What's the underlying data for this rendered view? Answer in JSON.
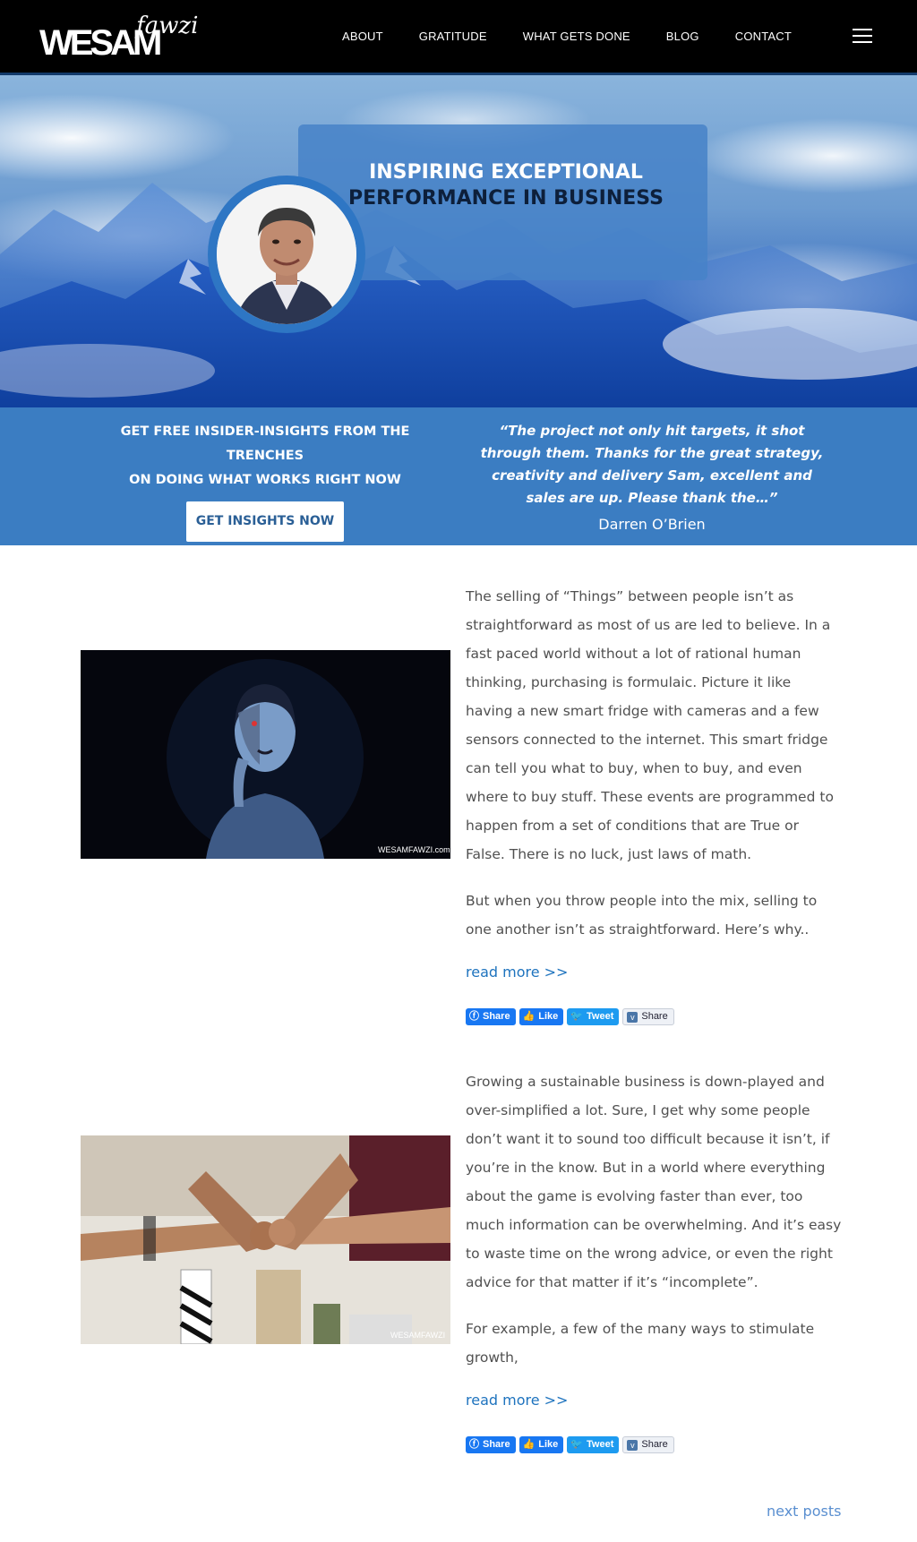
{
  "header": {
    "logo_main": "WESAM",
    "logo_script": "fawzi",
    "nav": [
      "ABOUT",
      "GRATITUDE",
      "WHAT GETS DONE",
      "BLOG",
      "CONTACT"
    ]
  },
  "hero": {
    "title_line1": "INSPIRING EXCEPTIONAL",
    "title_line2": "PERFORMANCE IN BUSINESS"
  },
  "band": {
    "insights_line1": "GET FREE INSIDER-INSIGHTS FROM THE TRENCHES",
    "insights_line2": "ON DOING WHAT WORKS RIGHT NOW",
    "cta_label": "GET INSIGHTS NOW",
    "quote": "“The project not only hit targets, it shot through them. Thanks for the great strategy, creativity and delivery Sam, excellent and sales are up. Please thank the…”",
    "quote_author": "Darren O’Brien"
  },
  "posts": [
    {
      "image_watermark": "WESAMFAWZI.com",
      "paragraphs": [
        "The selling of “Things” between people isn’t as straightforward as most of us are led to believe. In a fast paced world without a lot of rational human thinking, purchasing is formulaic.  Picture it like having a new smart fridge with cameras and a few sensors connected to the internet. This smart fridge can tell you what to buy, when to buy, and even where to buy stuff. These events are programmed to happen from a set of conditions that are True or False. There is no luck, just laws of math.",
        "But when you throw people into the mix, selling to one another isn’t as straightforward. Here’s why.."
      ],
      "read_more": "read more >>",
      "share_buttons": [
        "Share",
        "Like",
        "Tweet",
        "Share"
      ]
    },
    {
      "image_watermark": "WESAMFAWZI",
      "paragraphs": [
        "Growing a sustainable business is down-played and over-simplified a lot. Sure, I get why some people don’t want it to sound too difficult because it isn’t, if you’re in the know. But in a world where everything about the game is evolving faster than ever, too much information can be overwhelming. And it’s easy to waste time on the wrong advice, or even the right advice for that matter if it’s “incomplete”.",
        "For example, a few of the many ways to stimulate growth,"
      ],
      "read_more": "read more >>",
      "share_buttons": [
        "Share",
        "Like",
        "Tweet",
        "Share"
      ]
    }
  ],
  "pagination": {
    "next": "next posts"
  },
  "colors": {
    "header_bg": "#000000",
    "band_bg": "#3b7dc2",
    "link": "#1e73be",
    "facebook": "#1877f2",
    "twitter": "#1d9bf0"
  }
}
